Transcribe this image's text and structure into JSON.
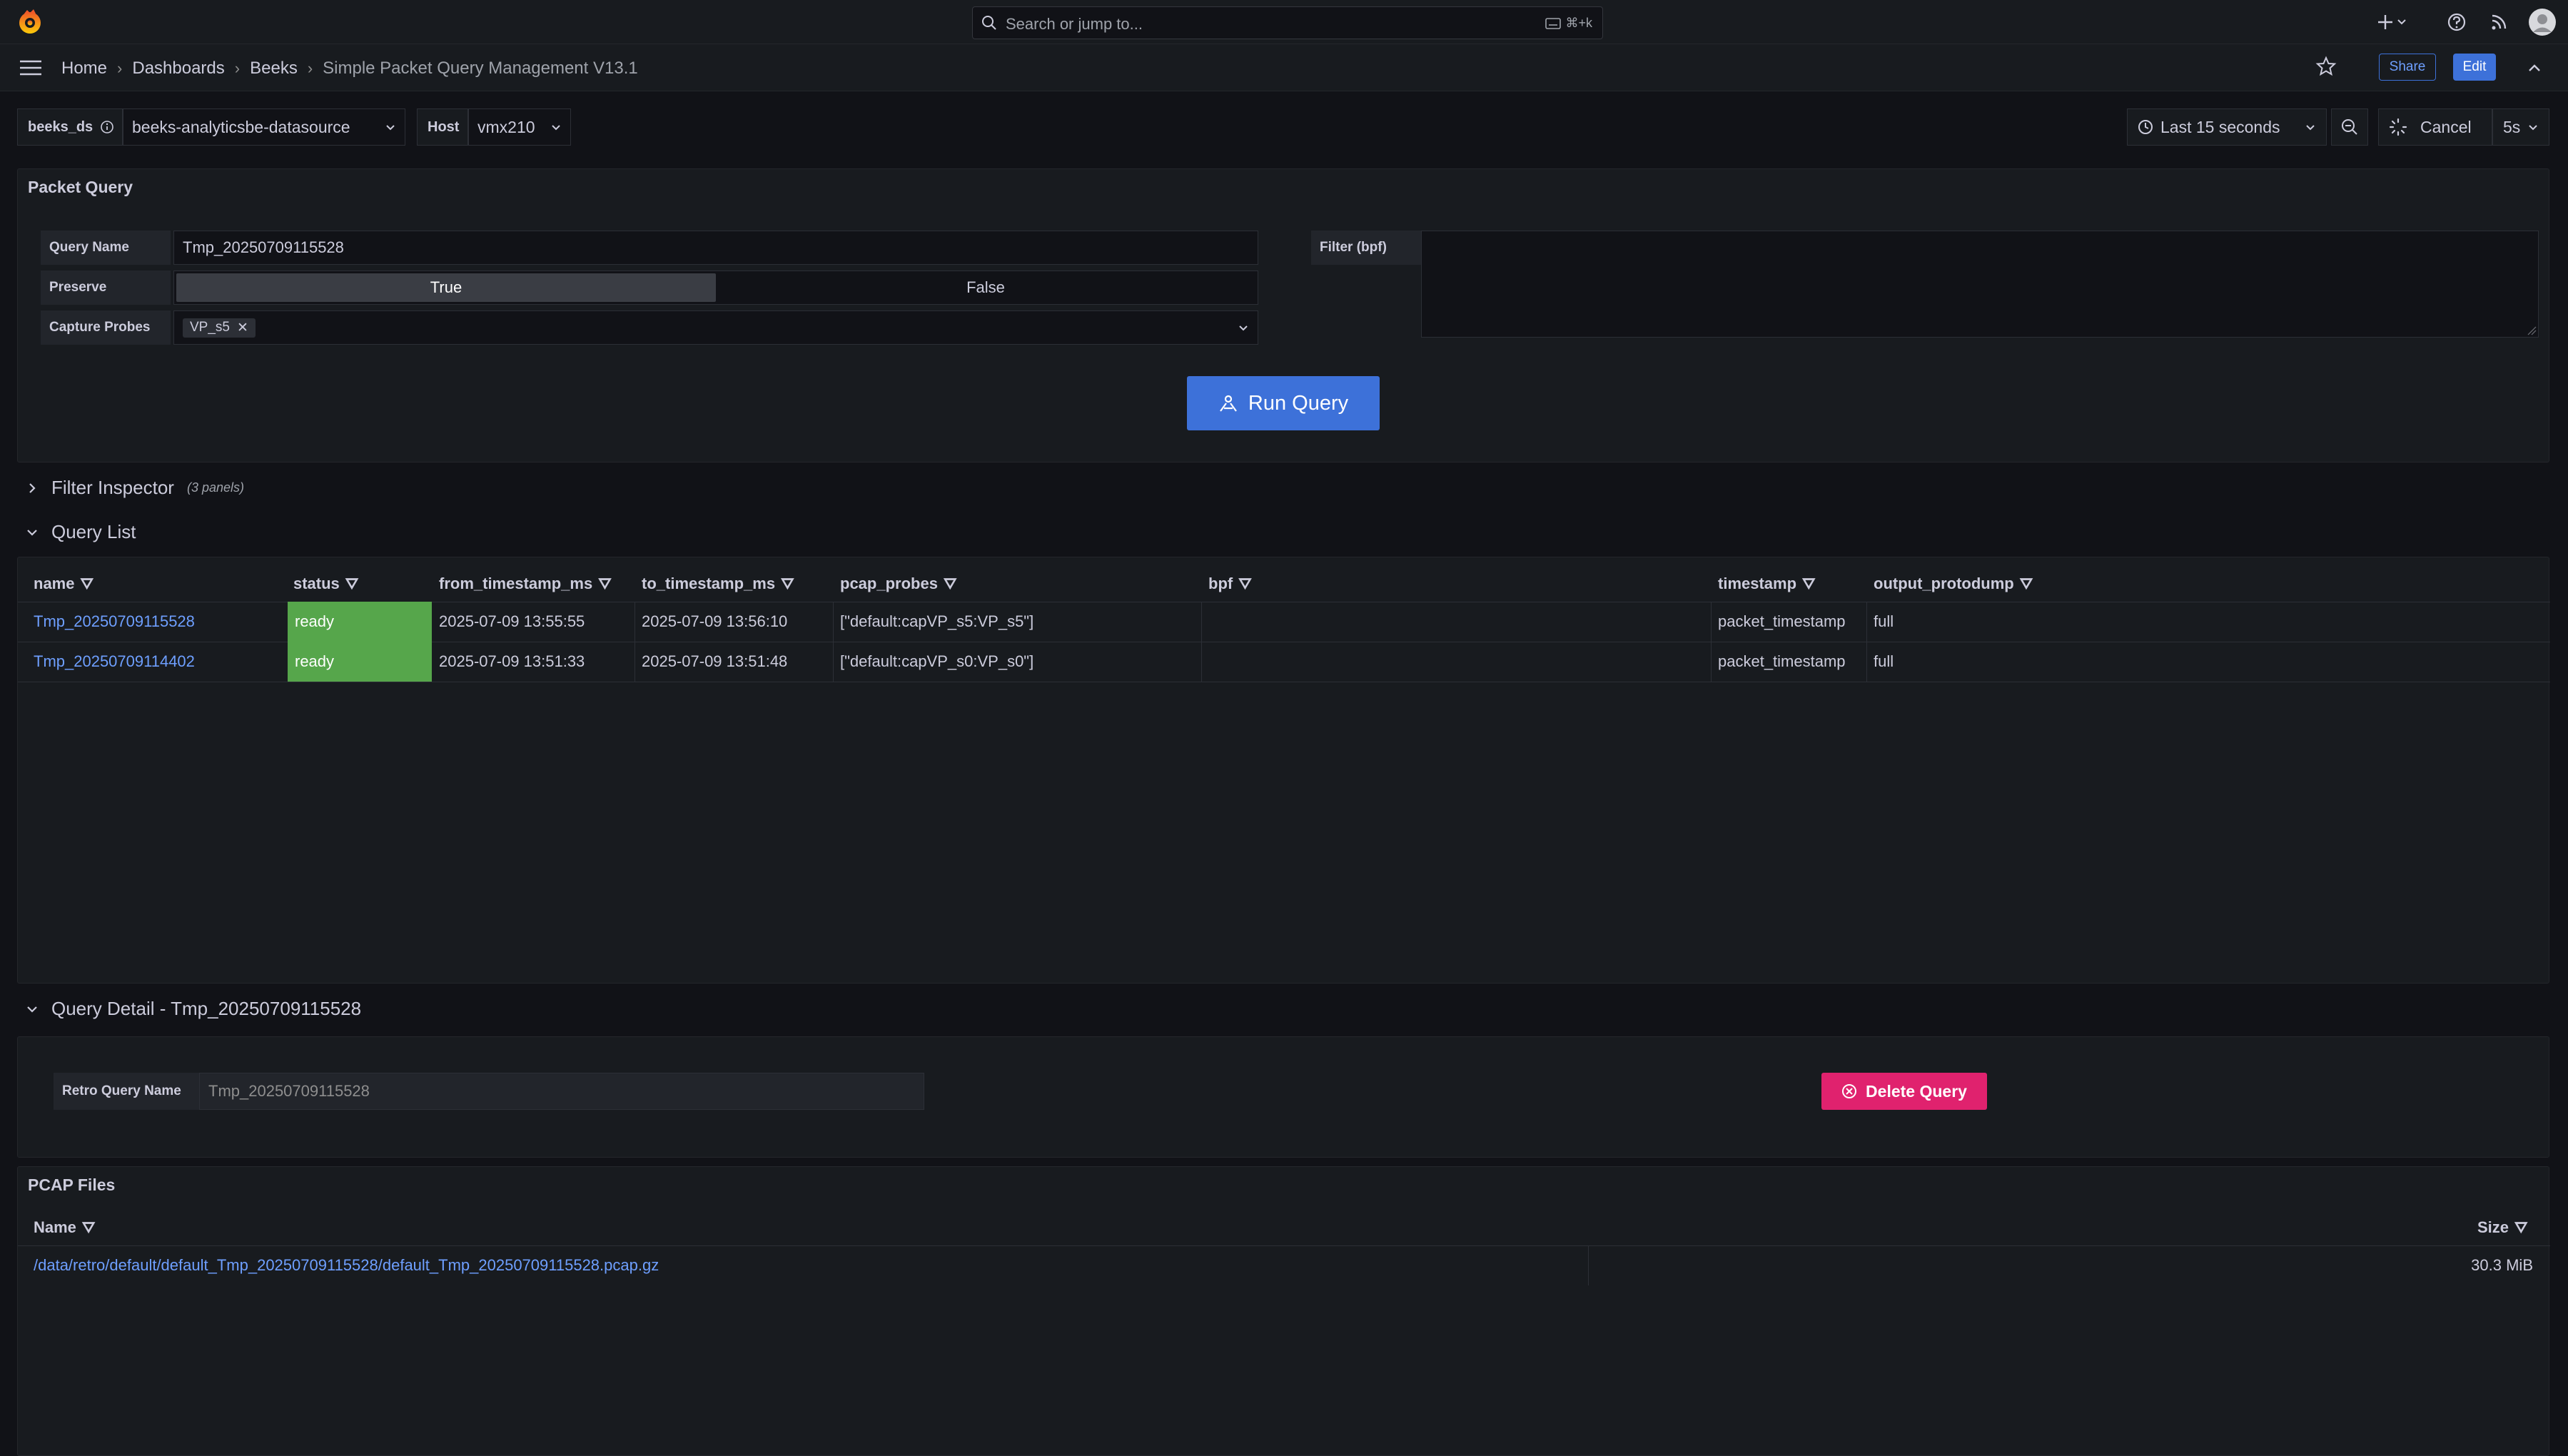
{
  "topbar": {
    "search_placeholder": "Search or jump to...",
    "search_shortcut": "⌘+k"
  },
  "breadcrumb": [
    "Home",
    "Dashboards",
    "Beeks",
    "Simple Packet Query Management V13.1"
  ],
  "actions": {
    "share": "Share",
    "edit": "Edit"
  },
  "variables": {
    "ds_label": "beeks_ds",
    "ds_value": "beeks-analyticsbe-datasource",
    "host_label": "Host",
    "host_value": "vmx210"
  },
  "time": {
    "range": "Last 15 seconds",
    "cancel": "Cancel",
    "refresh": "5s"
  },
  "packet_query": {
    "title": "Packet Query",
    "query_name_label": "Query Name",
    "query_name_value": "Tmp_20250709115528",
    "preserve_label": "Preserve",
    "preserve_true": "True",
    "preserve_false": "False",
    "capture_label": "Capture Probes",
    "capture_chip": "VP_s5",
    "filter_label": "Filter (bpf)",
    "run_button": "Run Query"
  },
  "filter_inspector": {
    "title": "Filter Inspector",
    "sub": "(3 panels)"
  },
  "query_list": {
    "title": "Query List",
    "columns": [
      "name",
      "status",
      "from_timestamp_ms",
      "to_timestamp_ms",
      "pcap_probes",
      "bpf",
      "timestamp",
      "output_protodump"
    ],
    "rows": [
      {
        "name": "Tmp_20250709115528",
        "status": "ready",
        "from": "2025-07-09 13:55:55",
        "to": "2025-07-09 13:56:10",
        "probes": "[\"default:capVP_s5:VP_s5\"]",
        "bpf": "",
        "timestamp": "packet_timestamp",
        "output": "full"
      },
      {
        "name": "Tmp_20250709114402",
        "status": "ready",
        "from": "2025-07-09 13:51:33",
        "to": "2025-07-09 13:51:48",
        "probes": "[\"default:capVP_s0:VP_s0\"]",
        "bpf": "",
        "timestamp": "packet_timestamp",
        "output": "full"
      }
    ]
  },
  "query_detail": {
    "title": "Query Detail - Tmp_20250709115528",
    "retro_label": "Retro Query Name",
    "retro_placeholder": "Tmp_20250709115528",
    "delete_button": "Delete Query"
  },
  "pcap_files": {
    "title": "PCAP Files",
    "col_name": "Name",
    "col_size": "Size",
    "rows": [
      {
        "name": "/data/retro/default/default_Tmp_20250709115528/default_Tmp_20250709115528.pcap.gz",
        "size": "30.3 MiB"
      }
    ]
  },
  "colors": {
    "accent": "#3d71d9",
    "ready": "#56a64b",
    "danger": "#e0226e",
    "link": "#6e9fff"
  }
}
